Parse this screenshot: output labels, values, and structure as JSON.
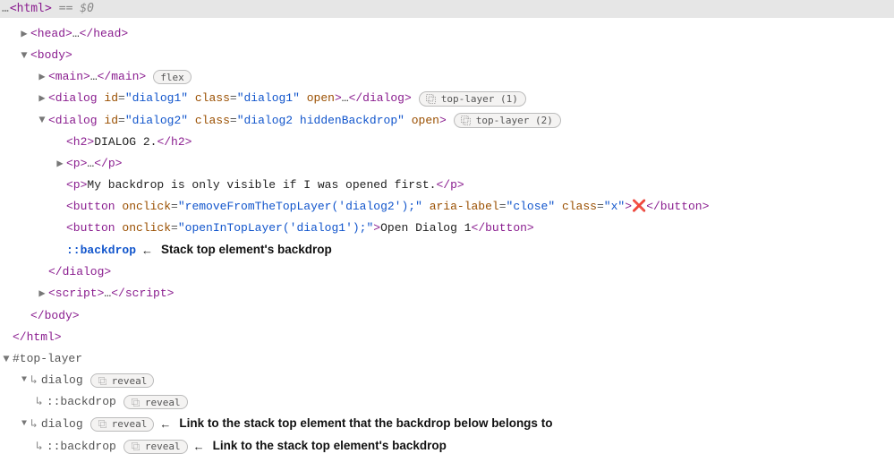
{
  "topbar": {
    "tag": "html",
    "suffix": " == ",
    "var": "$0"
  },
  "glyph": {
    "collapsed": "▶",
    "expanded": "▼",
    "curve": "↳",
    "left_arrow": "←",
    "cross": "❌"
  },
  "badges": {
    "flex": "flex",
    "tl1": "top-layer (1)",
    "tl2": "top-layer (2)",
    "reveal": "reveal"
  },
  "tags": {
    "head_open": "<head>",
    "head_close": "</head>",
    "body_open": "<body>",
    "body_close": "</body>",
    "main_open": "<main>",
    "main_close": "</main>",
    "dialog_close": "</dialog>",
    "h2_open": "<h2>",
    "h2_close": "</h2>",
    "p_open": "<p>",
    "p_close": "</p>",
    "button_close": "</button>",
    "script_open": "<script>",
    "script_close": "</script>",
    "html_close": "</html>",
    "backdrop": "::backdrop",
    "dialog_word": "dialog"
  },
  "dialog1": {
    "open": "<dialog ",
    "attrs": [
      {
        "n": "id",
        "v": "\"dialog1\""
      },
      {
        "n": "class",
        "v": "\"dialog1\""
      },
      {
        "n": "open",
        "v": null
      }
    ],
    "mid": ">"
  },
  "dialog2": {
    "open": "<dialog ",
    "attrs": [
      {
        "n": "id",
        "v": "\"dialog2\""
      },
      {
        "n": "class",
        "v": "\"dialog2 hiddenBackdrop\""
      },
      {
        "n": "open",
        "v": null
      }
    ],
    "mid": ">"
  },
  "h2_text": "DIALOG 2.",
  "p2_text": "My backdrop is only visible if I was opened first.",
  "btn_close": {
    "open": "<button ",
    "attrs": [
      {
        "n": "onclick",
        "v": "\"removeFromTheTopLayer('dialog2');\""
      },
      {
        "n": "aria-label",
        "v": "\"close\""
      },
      {
        "n": "class",
        "v": "\"x\""
      }
    ],
    "mid": ">"
  },
  "btn_open1": {
    "open": "<button ",
    "attrs": [
      {
        "n": "onclick",
        "v": "\"openInTopLayer('dialog1');\""
      }
    ],
    "mid": ">",
    "text": "Open Dialog 1"
  },
  "annot": {
    "backdrop_stack_top": "Stack top element's backdrop",
    "link_stack_top": "Link to the stack top element that the backdrop below belongs to",
    "link_backdrop": "Link to the stack top element's backdrop"
  },
  "toplayer_label": "#top-layer"
}
